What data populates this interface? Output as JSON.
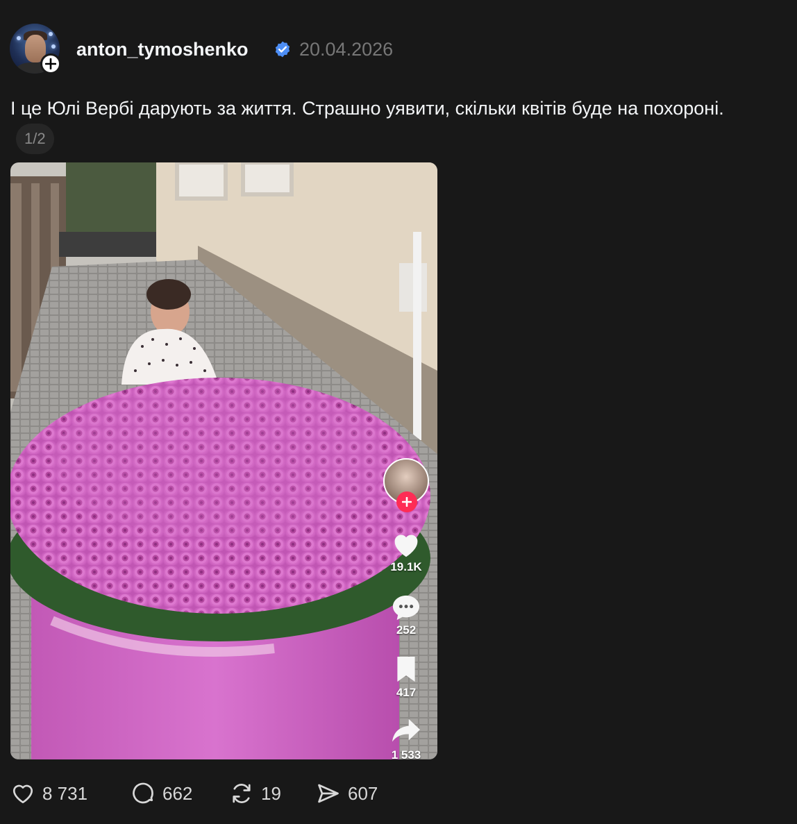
{
  "post": {
    "username": "anton_tymoshenko",
    "date": "20.04.2026",
    "caption": "І це Юлі Вербі дарують за життя. Страшно уявити, скільки квітів буде на похороні.",
    "pager": "1/2"
  },
  "video_overlay": {
    "likes": "19.1K",
    "comments": "252",
    "saves": "417",
    "shares": "1 533"
  },
  "actions": {
    "likes": "8 731",
    "replies": "662",
    "reposts": "19",
    "shares": "607"
  },
  "icons": {
    "verified": "verified-badge-icon",
    "like": "heart-icon",
    "reply": "comment-bubble-icon",
    "repost": "repost-icon",
    "share": "send-icon"
  },
  "colors": {
    "background": "#181818",
    "verified": "#4d8ef5",
    "muted": "#777777",
    "plus_red": "#fe2c55"
  }
}
